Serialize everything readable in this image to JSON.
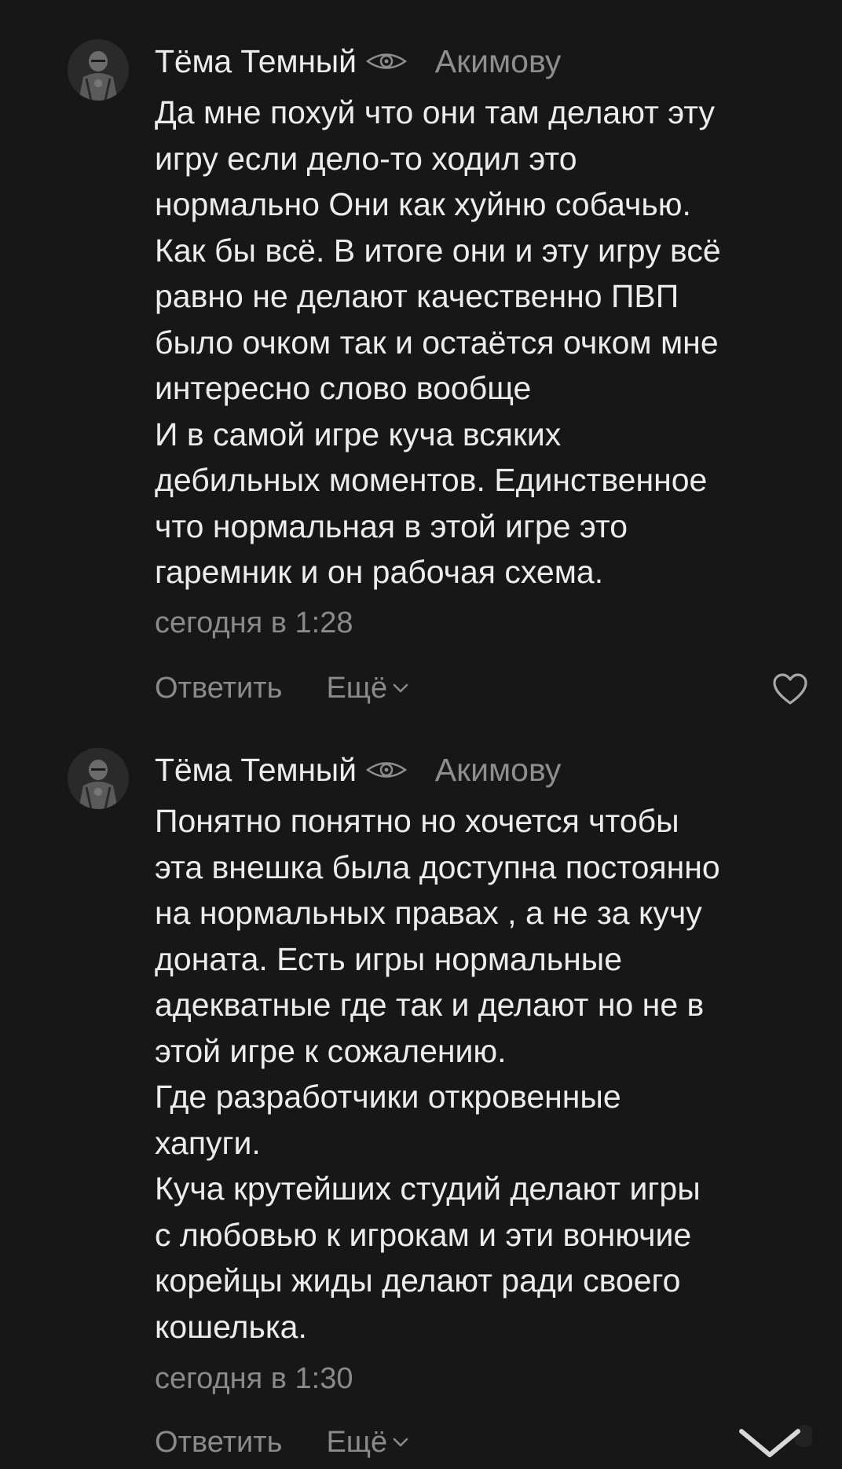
{
  "comments": [
    {
      "author": "Тёма Темный",
      "badge_icon": "eye-icon",
      "reply_to": "Акимову",
      "text_lines": [
        "Да мне похуй что они там делают эту",
        "игру если дело-то ходил это",
        "нормально Они как хуйню собачью.",
        "Как бы всё. В итоге они и эту игру всё",
        "равно не делают качественно ПВП",
        "было очком так и остаётся очком мне",
        "интересно слово вообще",
        "И в самой игре куча всяких",
        "дебильных моментов. Единственное",
        "что нормальная в этой игре это",
        "гаремник и он рабочая схема."
      ],
      "time": "сегодня в 1:28",
      "reply_label": "Ответить",
      "more_label": "Ещё",
      "like_icon": "heart-icon"
    },
    {
      "author": "Тёма Темный",
      "badge_icon": "eye-icon",
      "reply_to": "Акимову",
      "text_lines": [
        "Понятно понятно но хочется чтобы",
        "эта внешка была доступна постоянно",
        "на нормальных правах , а не за кучу",
        "доната. Есть игры нормальные",
        "адекватные где так и делают но не в",
        "этой игре к сожалению.",
        "Где разработчики откровенные",
        "хапуги.",
        "Куча крутейших студий делают игры",
        "с любовью к игрокам и эти вонючие",
        "корейцы жиды делают ради своего",
        "кошелька."
      ],
      "time": "сегодня в 1:30",
      "reply_label": "Ответить",
      "more_label": "Ещё"
    }
  ],
  "scroll_button_icon": "chevron-down-icon",
  "colors": {
    "background": "#171717",
    "text": "#ececec",
    "muted": "#8a8a8a"
  }
}
